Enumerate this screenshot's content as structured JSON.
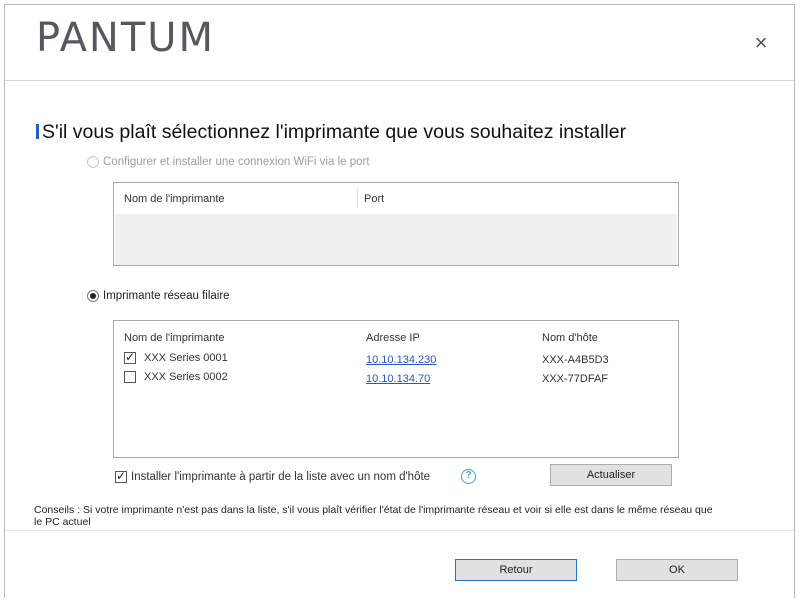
{
  "header": {
    "logo": "PANTUM",
    "close_glyph": "×"
  },
  "main": {
    "title": "S'il vous plaît sélectionnez l'imprimante que vous souhaitez installer",
    "wifi_option": {
      "label": "Configurer et installer une connexion WiFi via le port",
      "selected": false,
      "enabled": false,
      "columns": [
        "Nom de l'imprimante",
        "Port"
      ]
    },
    "wired_option": {
      "label": "Imprimante réseau filaire",
      "selected": true,
      "columns": [
        "Nom de l'imprimante",
        "Adresse IP",
        "Nom d'hôte"
      ],
      "rows": [
        {
          "checked": true,
          "name": "XXX Series 0001",
          "ip": "10.10.134.230",
          "host": "XXX-A4B5D3"
        },
        {
          "checked": false,
          "name": "XXX Series 0002",
          "ip": "10.10.134.70",
          "host": "XXX-77DFAF"
        }
      ]
    },
    "hostname_checkbox": {
      "checked": true,
      "label": "Installer l'imprimante à partir de la liste avec un nom d'hôte"
    },
    "help_glyph": "?",
    "refresh_label": "Actualiser",
    "tips": "Conseils : Si votre imprimante n'est pas dans la liste, s'il vous plaît vérifier l'état de l'imprimante réseau et voir si elle est dans le même réseau que le PC actuel"
  },
  "footer": {
    "back_label": "Retour",
    "ok_label": "OK"
  },
  "colors": {
    "accent": "#1d62c9",
    "link": "#2b55c6",
    "help": "#3a9ee4"
  }
}
